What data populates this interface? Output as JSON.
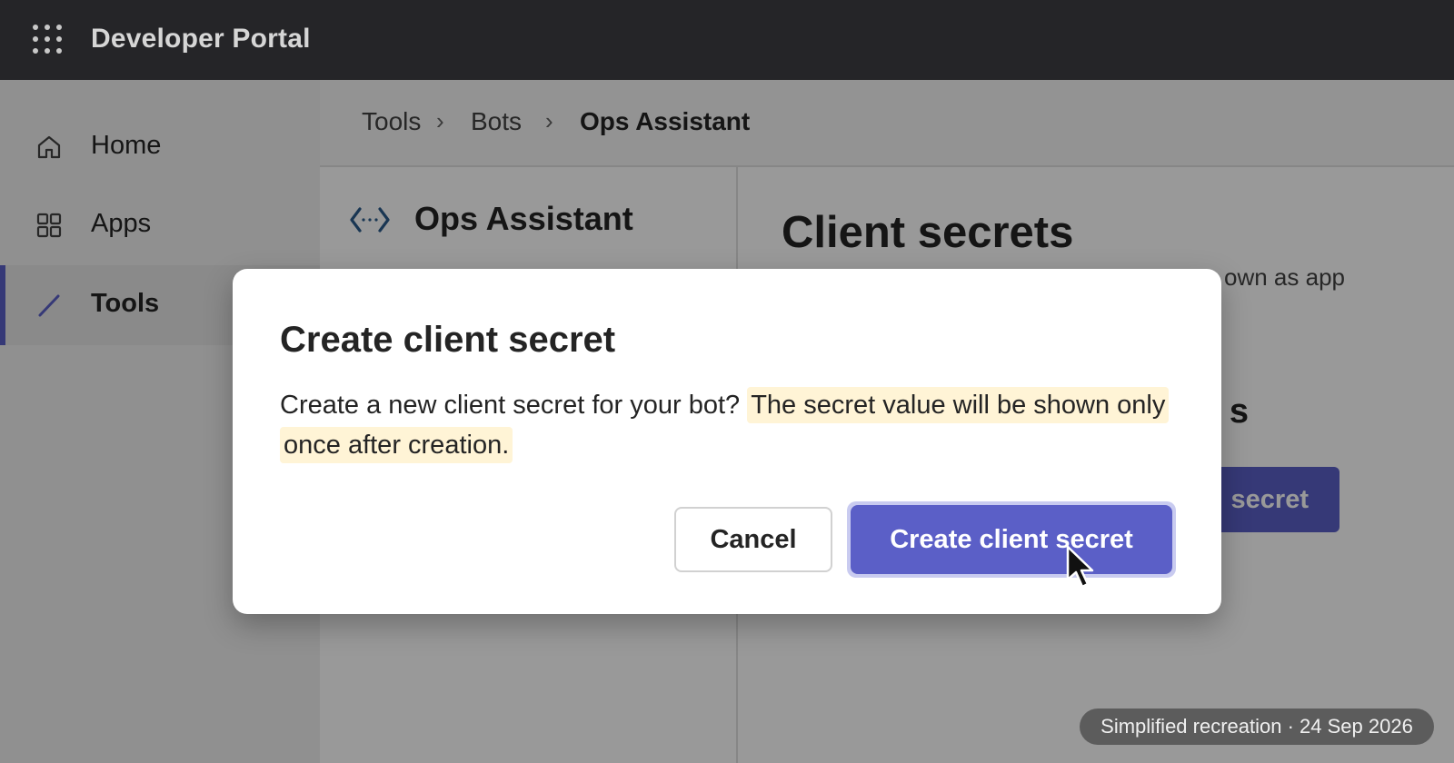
{
  "app": {
    "title": "Developer Portal"
  },
  "sidebar": {
    "items": [
      {
        "label": "Home",
        "icon": "home-icon",
        "active": false
      },
      {
        "label": "Apps",
        "icon": "apps-grid-icon",
        "active": false
      },
      {
        "label": "Tools",
        "icon": "pencil-icon",
        "active": true
      }
    ]
  },
  "breadcrumb": {
    "items": [
      "Tools",
      "Bots",
      "Ops Assistant"
    ]
  },
  "bot": {
    "name": "Ops Assistant",
    "icon": "code-bracket-icon"
  },
  "page": {
    "title": "Client secrets",
    "description_visible": "own as app",
    "section_heading_visible": "s",
    "create_button_visible": "secret"
  },
  "dialog": {
    "title": "Create client secret",
    "body_plain": "Create a new client secret for your bot? ",
    "body_highlight": "The secret value will be shown only once after creation.",
    "cancel_label": "Cancel",
    "confirm_label": "Create client secret"
  },
  "footer": {
    "badge": "Simplified recreation · 24 Sep 2026"
  },
  "colors": {
    "accent": "#5b5fc7",
    "topbar": "#252528",
    "highlight": "#fff4d6"
  }
}
